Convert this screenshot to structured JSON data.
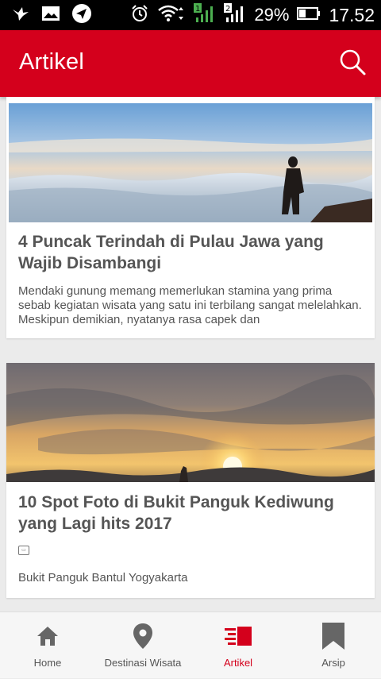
{
  "status_bar": {
    "battery_percent": "29%",
    "time": "17.52",
    "sim1": "1",
    "sim2": "2"
  },
  "app_bar": {
    "title": "Artikel"
  },
  "articles": [
    {
      "title": "4 Puncak Terindah di Pulau Jawa yang Wajib Disambangi",
      "excerpt": "Mendaki gunung memang memerlukan stamina yang prima sebab kegiatan wisata yang satu ini terbilang sangat melelahkan. Meskipun demikian, nyatanya rasa capek dan"
    },
    {
      "title": "10 Spot Foto di Bukit Panguk Kediwung yang Lagi hits 2017",
      "caption": "Bukit Panguk Bantul Yogyakarta"
    }
  ],
  "bottom_nav": {
    "items": [
      {
        "label": "Home",
        "icon": "home-icon"
      },
      {
        "label": "Destinasi Wisata",
        "icon": "map-pin-icon"
      },
      {
        "label": "Artikel",
        "icon": "article-icon"
      },
      {
        "label": "Arsip",
        "icon": "bookmark-icon"
      }
    ],
    "active": "Artikel"
  },
  "colors": {
    "primary": "#d4001c",
    "background": "#ebebeb",
    "text": "#555555"
  }
}
